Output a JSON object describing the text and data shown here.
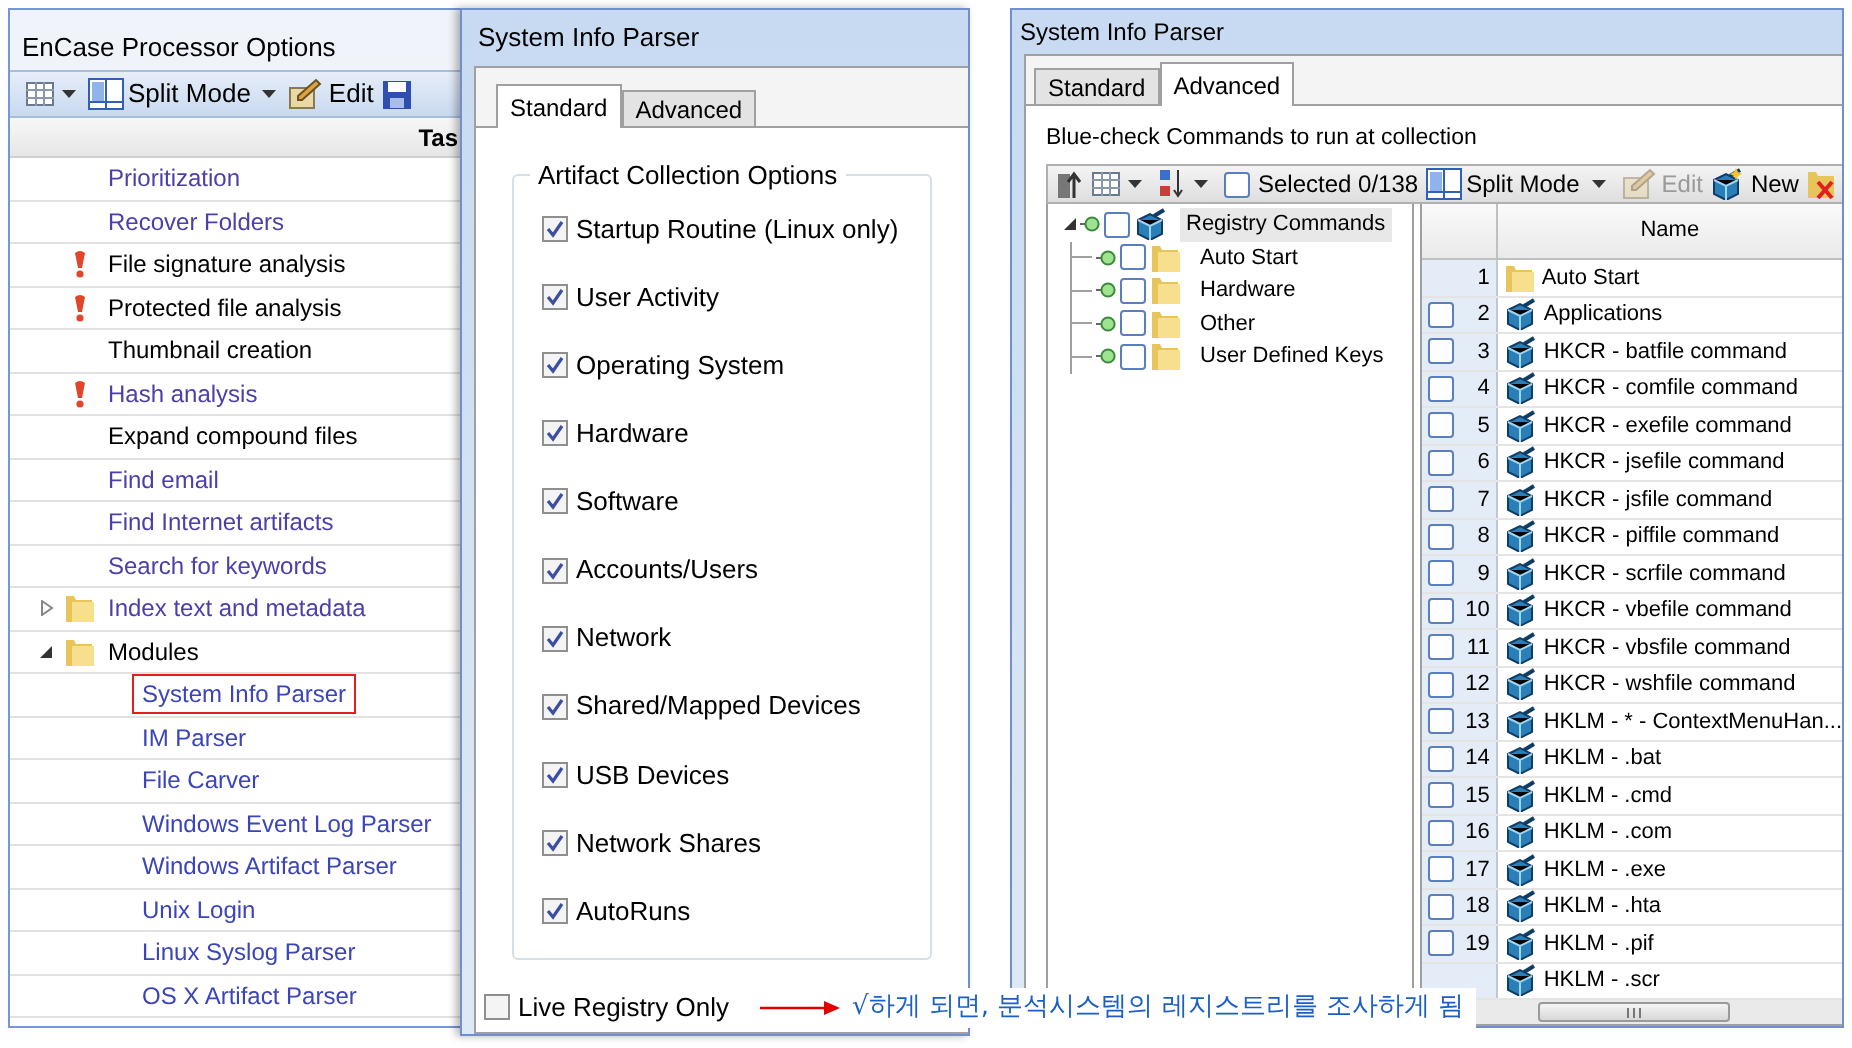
{
  "left": {
    "title": "EnCase Processor Options",
    "toolbar": [
      {
        "kind": "grid"
      },
      {
        "kind": "split",
        "label": "Split Mode"
      },
      {
        "kind": "edit",
        "label": "Edit"
      },
      {
        "kind": "save"
      }
    ],
    "column_header": "Tas",
    "items": [
      {
        "label": "Prioritization",
        "warning": false,
        "color": "#4b3fa9"
      },
      {
        "label": "Recover Folders",
        "warning": false,
        "color": "#4b3fa9"
      },
      {
        "label": "File signature analysis",
        "warning": true,
        "color": "#000000"
      },
      {
        "label": "Protected file analysis",
        "warning": true,
        "color": "#000000"
      },
      {
        "label": "Thumbnail creation",
        "warning": false,
        "color": "#000000"
      },
      {
        "label": "Hash analysis",
        "warning": true,
        "color": "#4b3fa9"
      },
      {
        "label": "Expand compound files",
        "warning": false,
        "color": "#000000"
      },
      {
        "label": "Find email",
        "warning": false,
        "color": "#4b3fa9"
      },
      {
        "label": "Find Internet artifacts",
        "warning": false,
        "color": "#4b3fa9"
      },
      {
        "label": "Search for keywords",
        "warning": false,
        "color": "#4b3fa9"
      },
      {
        "label": "Index text and metadata",
        "kind": "folder",
        "expanded": false,
        "color": "#4b3fa9"
      },
      {
        "label": "Modules",
        "kind": "folder",
        "expanded": true,
        "color": "#000000",
        "children": [
          {
            "label": "System Info Parser",
            "highlighted": true,
            "color": "#3b44b8"
          },
          {
            "label": "IM Parser",
            "highlighted": false,
            "color": "#3b44b8"
          },
          {
            "label": "File Carver",
            "highlighted": false,
            "color": "#3b44b8"
          },
          {
            "label": "Windows Event Log Parser",
            "highlighted": false,
            "color": "#3b44b8"
          },
          {
            "label": "Windows Artifact Parser",
            "highlighted": false,
            "color": "#3b44b8"
          },
          {
            "label": "Unix Login",
            "highlighted": false,
            "color": "#3b44b8"
          },
          {
            "label": "Linux Syslog Parser",
            "highlighted": false,
            "color": "#3b44b8"
          },
          {
            "label": "OS X Artifact Parser",
            "highlighted": false,
            "color": "#3b44b8"
          }
        ]
      }
    ]
  },
  "middle": {
    "title": "System Info Parser",
    "tabs": [
      {
        "label": "Standard",
        "selected": true
      },
      {
        "label": "Advanced",
        "selected": false
      }
    ],
    "group": "Artifact Collection Options",
    "options": [
      {
        "label": "Startup Routine (Linux only)",
        "checked": true
      },
      {
        "label": "User Activity",
        "checked": true
      },
      {
        "label": "Operating System",
        "checked": true
      },
      {
        "label": "Hardware",
        "checked": true
      },
      {
        "label": "Software",
        "checked": true
      },
      {
        "label": "Accounts/Users",
        "checked": true
      },
      {
        "label": "Network",
        "checked": true
      },
      {
        "label": "Shared/Mapped Devices",
        "checked": true
      },
      {
        "label": "USB Devices",
        "checked": true
      },
      {
        "label": "Network Shares",
        "checked": true
      },
      {
        "label": "AutoRuns",
        "checked": true
      }
    ],
    "live_registry": {
      "label": "Live Registry Only",
      "checked": false
    }
  },
  "right": {
    "title": "System Info Parser",
    "tabs": [
      {
        "label": "Standard",
        "selected": false
      },
      {
        "label": "Advanced",
        "selected": true
      }
    ],
    "instruction": "Blue-check Commands to run at collection",
    "toolbar": [
      {
        "kind": "up"
      },
      {
        "kind": "grid"
      },
      {
        "kind": "sort"
      },
      {
        "kind": "select",
        "label": "Selected 0/138",
        "checked": false
      },
      {
        "kind": "split",
        "label": "Split Mode"
      },
      {
        "kind": "edit",
        "label": "Edit",
        "disabled": true
      },
      {
        "kind": "new",
        "label": "New",
        "disabled": false
      },
      {
        "kind": "delete"
      }
    ],
    "tree": {
      "label": "Registry Commands",
      "kind": "command",
      "checked": false,
      "expanded": true,
      "children": [
        {
          "label": "Auto Start",
          "kind": "folder",
          "checked": false
        },
        {
          "label": "Hardware",
          "kind": "folder",
          "checked": false
        },
        {
          "label": "Other",
          "kind": "folder",
          "checked": false
        },
        {
          "label": "User Defined Keys",
          "kind": "folder",
          "checked": false
        }
      ]
    },
    "table": {
      "columns": [
        "Name"
      ],
      "rows": [
        {
          "number": "1",
          "name": "Auto Start",
          "kind": "folder"
        },
        {
          "number": "2",
          "name": "Applications",
          "kind": "command",
          "checked": false
        },
        {
          "number": "3",
          "name": "HKCR - batfile command",
          "kind": "command",
          "checked": false
        },
        {
          "number": "4",
          "name": "HKCR - comfile command",
          "kind": "command",
          "checked": false
        },
        {
          "number": "5",
          "name": "HKCR - exefile command",
          "kind": "command",
          "checked": false
        },
        {
          "number": "6",
          "name": "HKCR - jsefile command",
          "kind": "command",
          "checked": false
        },
        {
          "number": "7",
          "name": "HKCR - jsfile command",
          "kind": "command",
          "checked": false
        },
        {
          "number": "8",
          "name": "HKCR - piffile command",
          "kind": "command",
          "checked": false
        },
        {
          "number": "9",
          "name": "HKCR - scrfile command",
          "kind": "command",
          "checked": false
        },
        {
          "number": "10",
          "name": "HKCR - vbefile command",
          "kind": "command",
          "checked": false
        },
        {
          "number": "11",
          "name": "HKCR - vbsfile command",
          "kind": "command",
          "checked": false
        },
        {
          "number": "12",
          "name": "HKCR - wshfile command",
          "kind": "command",
          "checked": false
        },
        {
          "number": "13",
          "name": "HKLM - * - ContextMenuHan...",
          "kind": "command",
          "checked": false
        },
        {
          "number": "14",
          "name": "HKLM - .bat",
          "kind": "command",
          "checked": false
        },
        {
          "number": "15",
          "name": "HKLM - .cmd",
          "kind": "command",
          "checked": false
        },
        {
          "number": "16",
          "name": "HKLM - .com",
          "kind": "command",
          "checked": false
        },
        {
          "number": "17",
          "name": "HKLM - .exe",
          "kind": "command",
          "checked": false
        },
        {
          "number": "18",
          "name": "HKLM - .hta",
          "kind": "command",
          "checked": false
        },
        {
          "number": "19",
          "name": "HKLM - .pif",
          "kind": "command",
          "checked": false
        },
        {
          "name": "HKLM - .scr",
          "kind": "command"
        }
      ]
    }
  },
  "annotation": "√하게 되면, 분석시스템의 레지스트리를 조사하게 됨"
}
